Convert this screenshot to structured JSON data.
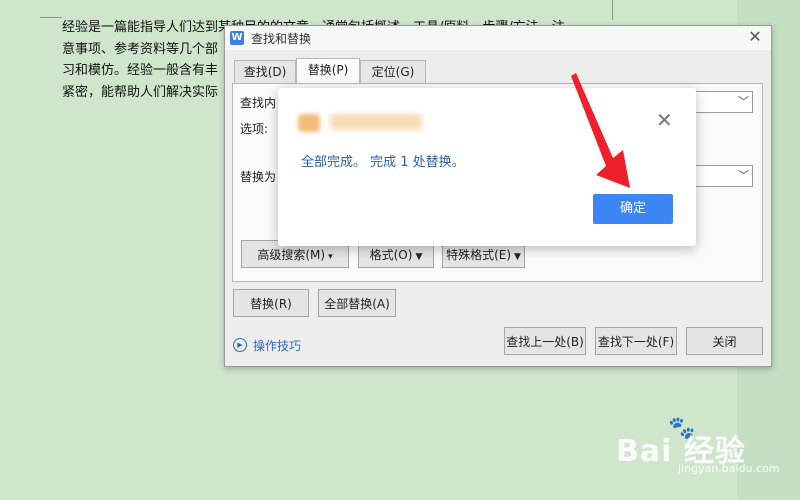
{
  "document": {
    "lines": [
      "经验是一篇能指导人们达到某种目的的文章，通常包括概述、工具/原料、步骤/方法、注",
      "意事项、参考资料等几个部",
      "习和模仿。经验一般含有丰",
      "紧密，能帮助人们解决实际"
    ]
  },
  "dialog": {
    "app_icon": "W",
    "title": "查找和替换",
    "close": "✕",
    "tabs": [
      {
        "label": "查找(D)"
      },
      {
        "label": "替换(P)",
        "active": true
      },
      {
        "label": "定位(G)"
      }
    ],
    "find_label": "查找内",
    "options_label": "选项:",
    "replace_label": "替换为",
    "buttons": {
      "advanced": "高级搜索(M)",
      "format": "格式(O)",
      "special": "特殊格式(E)",
      "replace": "替换(R)",
      "replace_all": "全部替换(A)",
      "find_prev": "查找上一处(B)",
      "find_next": "查找下一处(F)",
      "close": "关闭"
    },
    "tips": "操作技巧"
  },
  "message_box": {
    "message": "全部完成。 完成 1 处替换。",
    "ok": "确定",
    "close": "✕"
  },
  "watermark": {
    "main": "Bai  经验",
    "sub": "jingyan.baidu.com"
  },
  "colors": {
    "background": "#cfe6cd",
    "accent": "#3b86f4",
    "arrow": "#f0202a"
  }
}
